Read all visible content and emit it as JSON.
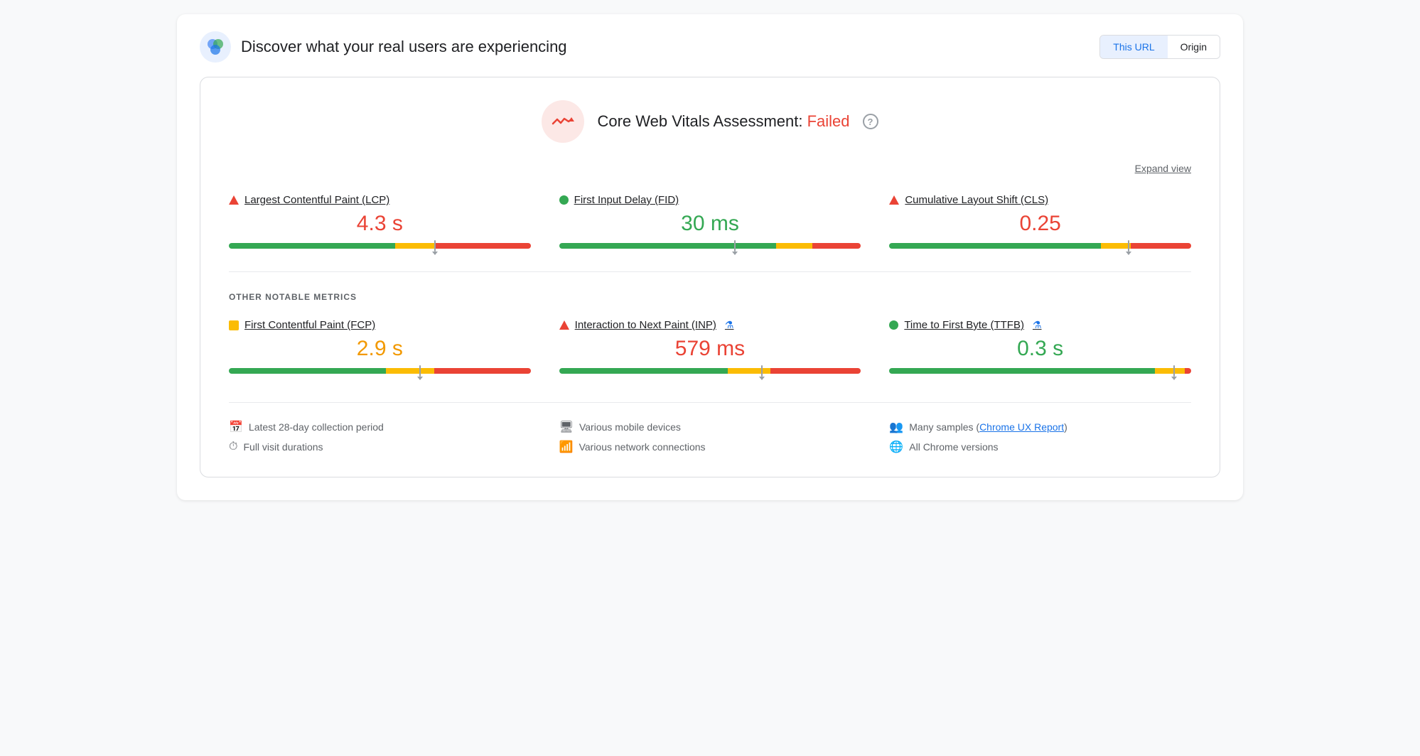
{
  "header": {
    "title": "Discover what your real users are experiencing",
    "url_button": "This URL",
    "origin_button": "Origin",
    "active_tab": "url"
  },
  "assessment": {
    "title": "Core Web Vitals Assessment:",
    "status": "Failed",
    "expand_label": "Expand view",
    "help_label": "?"
  },
  "core_metrics": [
    {
      "id": "lcp",
      "label": "Largest Contentful Paint (LCP)",
      "value": "4.3 s",
      "value_color": "red",
      "indicator": "triangle-red",
      "bar": {
        "green": 55,
        "orange": 13,
        "marker_pct": 68
      }
    },
    {
      "id": "fid",
      "label": "First Input Delay (FID)",
      "value": "30 ms",
      "value_color": "green",
      "indicator": "circle-green",
      "bar": {
        "green": 72,
        "orange": 12,
        "marker_pct": 58
      }
    },
    {
      "id": "cls",
      "label": "Cumulative Layout Shift (CLS)",
      "value": "0.25",
      "value_color": "red",
      "indicator": "triangle-red",
      "bar": {
        "green": 70,
        "orange": 10,
        "marker_pct": 79
      }
    }
  ],
  "other_metrics_label": "OTHER NOTABLE METRICS",
  "other_metrics": [
    {
      "id": "fcp",
      "label": "First Contentful Paint (FCP)",
      "value": "2.9 s",
      "value_color": "orange",
      "indicator": "square-orange",
      "has_flask": false,
      "bar": {
        "green": 52,
        "orange": 16,
        "marker_pct": 63
      }
    },
    {
      "id": "inp",
      "label": "Interaction to Next Paint (INP)",
      "value": "579 ms",
      "value_color": "red",
      "indicator": "triangle-red",
      "has_flask": true,
      "bar": {
        "green": 56,
        "orange": 14,
        "marker_pct": 67
      }
    },
    {
      "id": "ttfb",
      "label": "Time to First Byte (TTFB)",
      "value": "0.3 s",
      "value_color": "green",
      "indicator": "circle-green",
      "has_flask": true,
      "bar": {
        "green": 88,
        "orange": 10,
        "marker_pct": 94
      }
    }
  ],
  "footer": [
    {
      "icon": "📅",
      "text": "Latest 28-day collection period"
    },
    {
      "icon": "🖥",
      "text": "Various mobile devices"
    },
    {
      "icon": "👥",
      "text": "Many samples (",
      "link": "Chrome UX Report",
      "text_after": ")"
    }
  ],
  "footer_row2": [
    {
      "icon": "⏱",
      "text": "Full visit durations"
    },
    {
      "icon": "📶",
      "text": "Various network connections"
    },
    {
      "icon": "🌐",
      "text": "All Chrome versions"
    }
  ]
}
